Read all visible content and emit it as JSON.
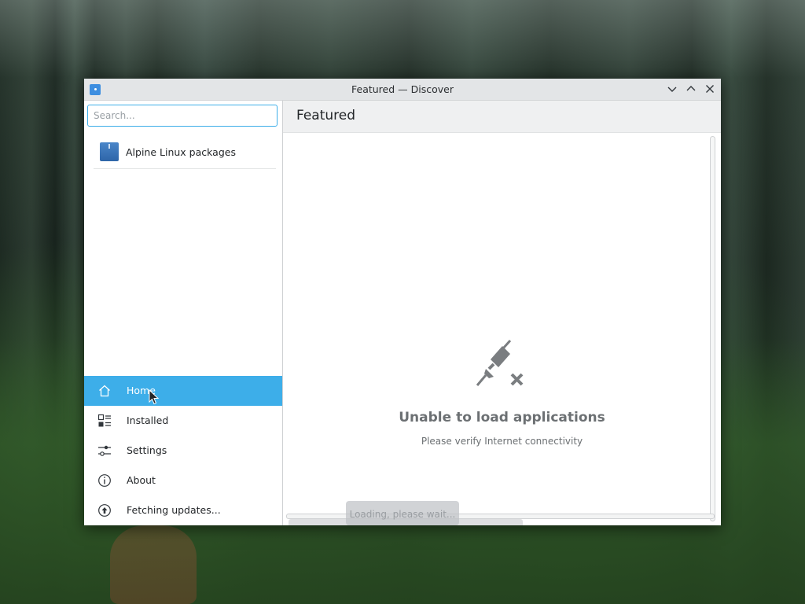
{
  "window": {
    "title": "Featured — Discover"
  },
  "sidebar": {
    "search_placeholder": "Search...",
    "sources": [
      {
        "label": "Alpine Linux packages",
        "icon": "package-icon"
      }
    ],
    "nav": [
      {
        "label": "Home",
        "icon": "home-icon",
        "active": true
      },
      {
        "label": "Installed",
        "icon": "installed-icon",
        "active": false
      },
      {
        "label": "Settings",
        "icon": "settings-icon",
        "active": false
      },
      {
        "label": "About",
        "icon": "info-icon",
        "active": false
      },
      {
        "label": "Fetching updates...",
        "icon": "update-icon",
        "active": false
      }
    ]
  },
  "main": {
    "title": "Featured",
    "empty_state": {
      "icon": "disconnected-plug-icon",
      "title": "Unable to load applications",
      "subtitle": "Please verify Internet connectivity"
    }
  },
  "overlay": {
    "loading_text": "Loading, please wait..."
  },
  "colors": {
    "accent": "#3daee9",
    "window_bg": "#eff0f1",
    "muted_text": "#6c7073"
  }
}
